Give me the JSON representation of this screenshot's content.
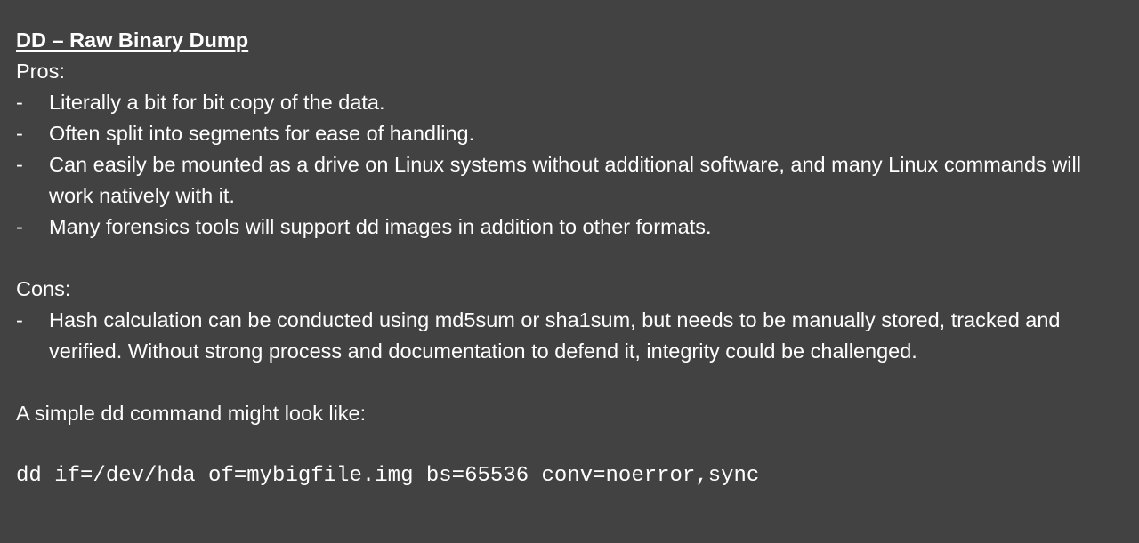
{
  "title": "DD – Raw Binary Dump",
  "pros": {
    "label": "Pros:",
    "items": [
      "Literally a bit for bit copy of the data.",
      "Often split into segments for ease of handling.",
      "Can easily be mounted as a drive on Linux systems without additional software, and many Linux commands will work natively with it.",
      "Many forensics tools will support dd images in addition to other formats."
    ]
  },
  "cons": {
    "label": "Cons:",
    "items": [
      "Hash calculation can be conducted using md5sum or sha1sum, but needs to be manually stored, tracked and verified.  Without strong process and documentation to defend it, integrity could be challenged."
    ]
  },
  "bullet_marker": "-",
  "intro": "A simple dd command might look like:",
  "command": "dd if=/dev/hda of=mybigfile.img bs=65536 conv=noerror,sync",
  "colors": {
    "background": "#424242",
    "text": "#ffffff"
  }
}
